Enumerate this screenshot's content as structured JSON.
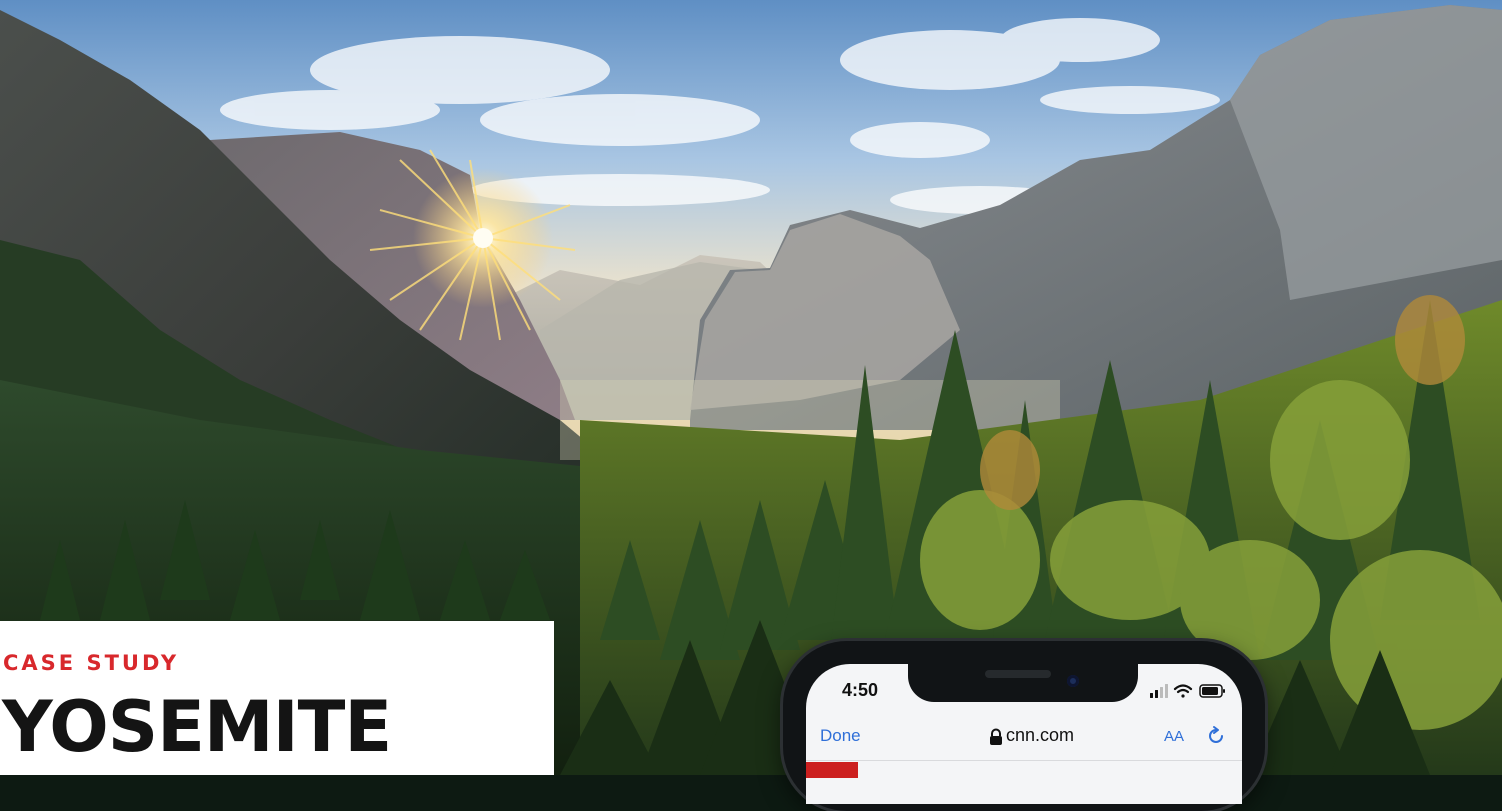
{
  "article": {
    "kicker": "CASE STUDY",
    "headline": "YOSEMITE"
  },
  "phone": {
    "status_time": "4:50",
    "browser": {
      "done_label": "Done",
      "domain": "cnn.com",
      "text_size_label": "AA"
    }
  },
  "colors": {
    "kicker_red": "#d8282c",
    "headline": "#141414",
    "link_blue": "#2f6fd8",
    "brand_red": "#cc1f1f"
  },
  "icons": [
    "lock-icon",
    "reload-icon",
    "signal-icon",
    "wifi-icon",
    "battery-icon"
  ]
}
